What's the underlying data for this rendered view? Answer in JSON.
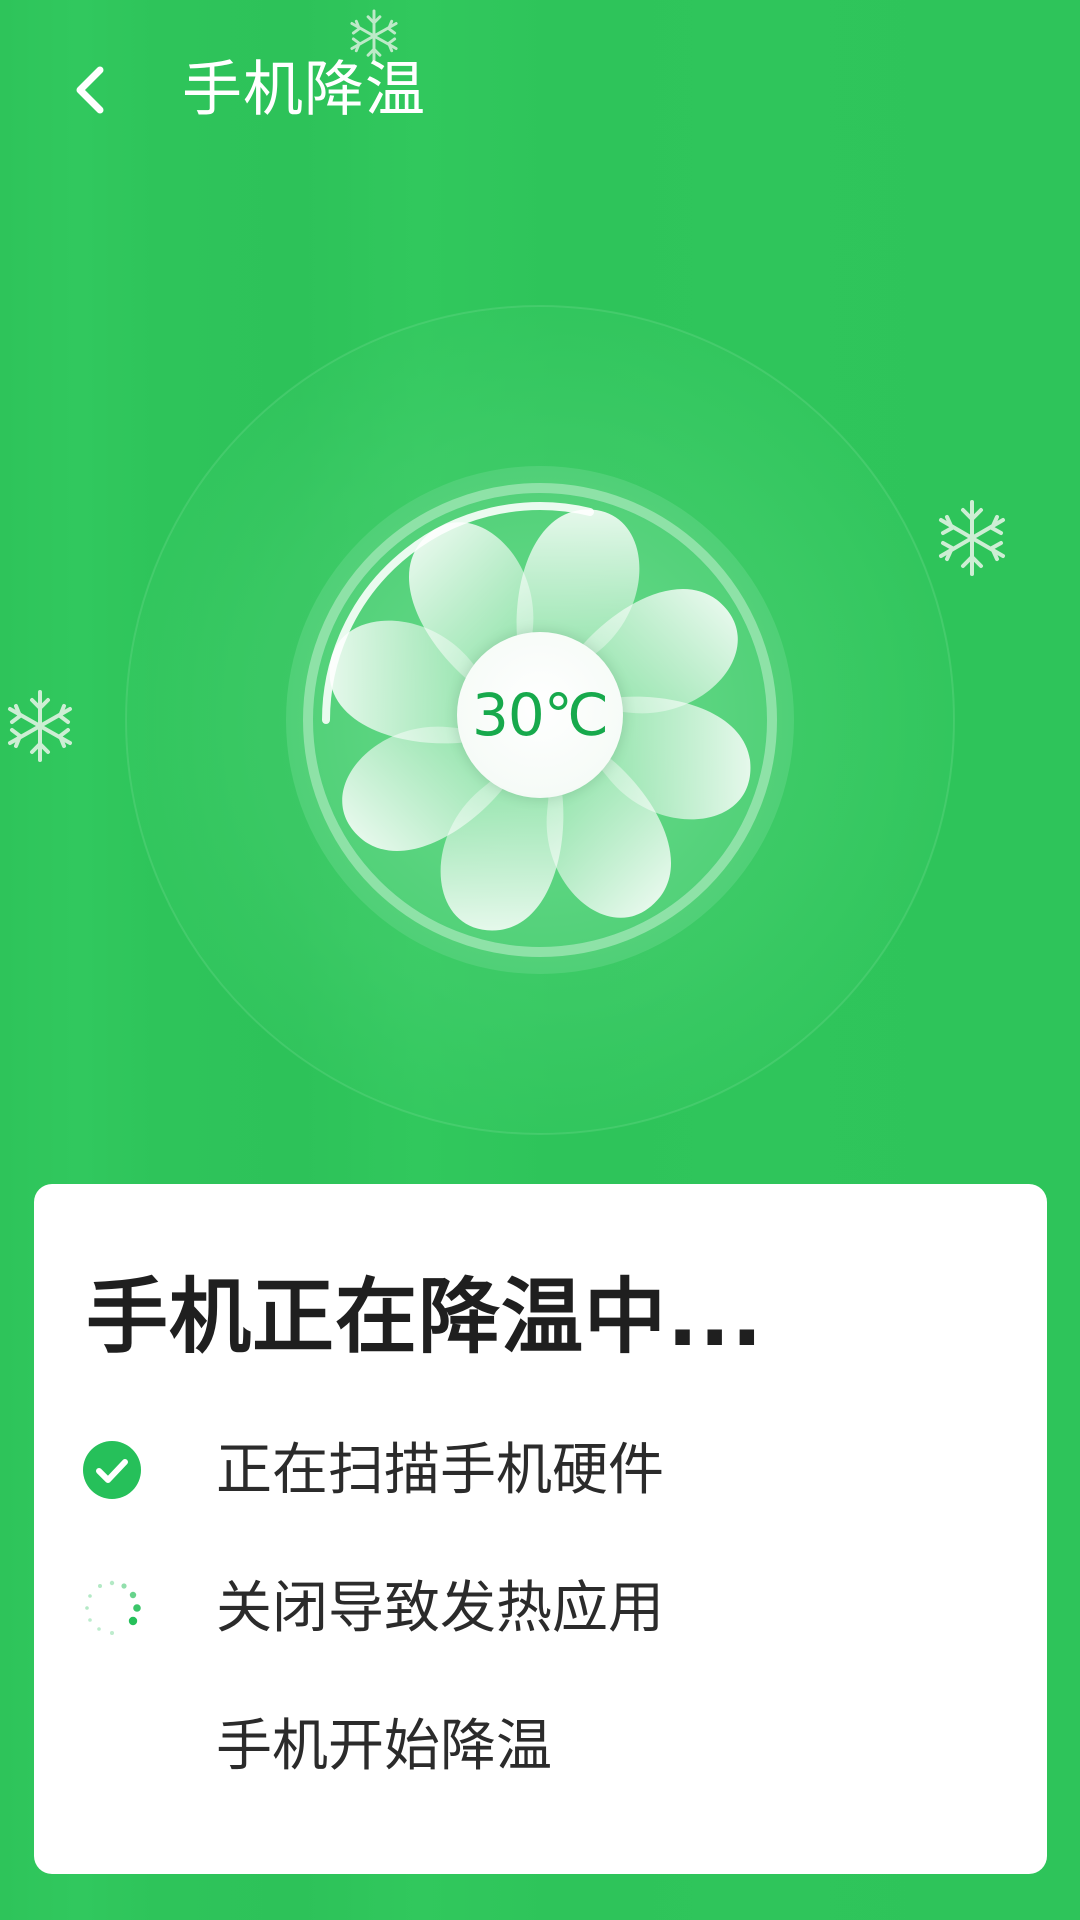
{
  "colors": {
    "background": "#2ec45a",
    "accent": "#17a94c",
    "card": "#ffffff",
    "text_dark": "#1f1f1f"
  },
  "header": {
    "back_icon": "chevron-left-icon",
    "title": "手机降温"
  },
  "fan": {
    "icon": "fan-icon",
    "temperature": "30℃"
  },
  "decorations": {
    "snowflake_icon": "snowflake-icon"
  },
  "status_card": {
    "title": "手机正在降温中...",
    "steps": [
      {
        "label": "正在扫描手机硬件",
        "state": "done",
        "icon": "check-circle-icon"
      },
      {
        "label": "关闭导致发热应用",
        "state": "in-progress",
        "icon": "spinner-icon"
      },
      {
        "label": "手机开始降温",
        "state": "pending",
        "icon": ""
      }
    ]
  }
}
